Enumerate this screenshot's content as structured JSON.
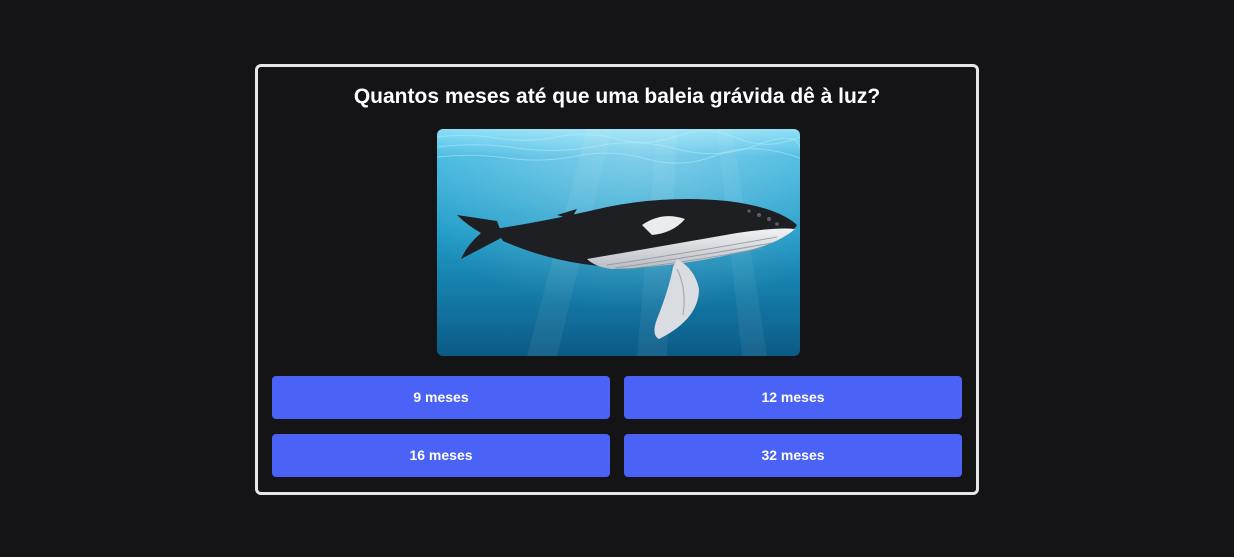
{
  "quiz": {
    "question": "Quantos meses até que uma baleia grávida dê à luz?",
    "image": {
      "subject": "humpback-whale-underwater",
      "colors": {
        "water_top": "#5fd0f0",
        "water_mid": "#1f9cc8",
        "water_bottom": "#0d5f8a",
        "whale_dark": "#1e1f22",
        "whale_light": "#e4e6ea"
      }
    },
    "answers": [
      {
        "label": "9 meses"
      },
      {
        "label": "12 meses"
      },
      {
        "label": "16 meses"
      },
      {
        "label": "32 meses"
      }
    ]
  },
  "theme": {
    "background": "#141416",
    "card_border": "#e6e6e6",
    "button_color": "#4a62f5",
    "text_color": "#ffffff"
  }
}
